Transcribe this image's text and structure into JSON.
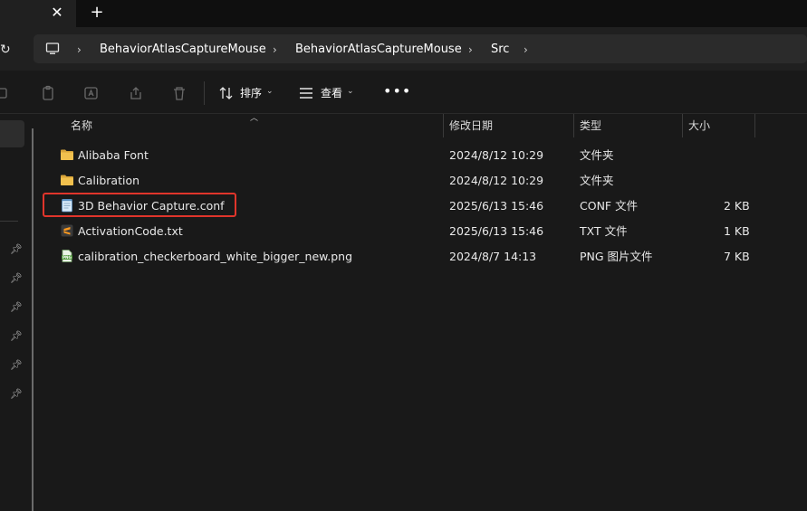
{
  "tabs": {
    "close_glyph": "✕",
    "new_glyph": "+"
  },
  "address": {
    "refresh_glyph": "↻",
    "crumbs": [
      "BehaviorAtlasCaptureMouse",
      "BehaviorAtlasCaptureMouse",
      "Src"
    ],
    "sep": "›"
  },
  "toolbar": {
    "sort_label": "排序",
    "view_label": "查看",
    "more_label": "•••",
    "caret": "⌄"
  },
  "columns": {
    "name": "名称",
    "modified": "修改日期",
    "type": "类型",
    "size": "大小"
  },
  "files": [
    {
      "name": "Alibaba Font",
      "modified": "2024/8/12 10:29",
      "type": "文件夹",
      "size": "",
      "icon": "folder-icon"
    },
    {
      "name": "Calibration",
      "modified": "2024/8/12 10:29",
      "type": "文件夹",
      "size": "",
      "icon": "folder-icon"
    },
    {
      "name": "3D Behavior Capture.conf",
      "modified": "2025/6/13 15:46",
      "type": "CONF 文件",
      "size": "2 KB",
      "icon": "notepad-icon"
    },
    {
      "name": "ActivationCode.txt",
      "modified": "2025/6/13 15:46",
      "type": "TXT 文件",
      "size": "1 KB",
      "icon": "sublime-icon"
    },
    {
      "name": "calibration_checkerboard_white_bigger_new.png",
      "modified": "2024/8/7 14:13",
      "type": "PNG 图片文件",
      "size": "7 KB",
      "icon": "png-icon"
    }
  ],
  "colors": {
    "highlight": "#e0352b",
    "folder": "#f2c14e",
    "background": "#191919"
  }
}
